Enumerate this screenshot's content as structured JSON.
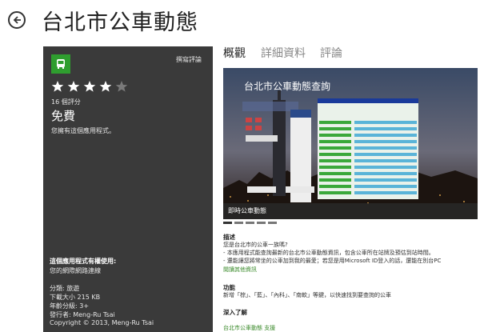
{
  "header": {
    "title": "台北市公車動態"
  },
  "panel": {
    "review_link": "撰寫評論",
    "rating": 4,
    "rating_max": 5,
    "rating_count": "16 個評分",
    "price": "免費",
    "owned_note": "您擁有這個應用程式。",
    "permissions_title": "這個應用程式有權使用:",
    "permissions": [
      "您的網際網路連線"
    ],
    "category": "分類: 旅遊",
    "download_size": "下載大小 215 KB",
    "age_rating": "年齡分級: 3+",
    "publisher": "發行者: Meng-Ru Tsai",
    "copyright": "Copyright © 2013, Meng-Ru Tsai"
  },
  "tabs": [
    "概觀",
    "詳細資料",
    "評論"
  ],
  "screenshot": {
    "app_heading": "台北市公車動態查詢",
    "caption": "即時公車動態",
    "pages": 5,
    "active_page": 0
  },
  "description": {
    "heading": "描述",
    "lines": [
      "您是台北市的公車一族嗎?",
      "- 本應用程式能查詢最新的台北市公車動態資訊，包含公車所在站牌及預估到站時間。",
      "- 還能讓您將常坐的公車加到我的最愛；若您是用Microsoft ID登入的話，還能在別台PC"
    ],
    "more_link": "閱讀其他資訊"
  },
  "features": {
    "heading": "功能",
    "line": "新增「棕」、「藍」、「內科」、「南軟」等鍵，以快速找到要查詢的公車"
  },
  "learn_more": {
    "heading": "深入了解",
    "link": "台北市公車動態 支援"
  },
  "colors": {
    "panel": "#3a3a3a",
    "accent": "#2f9e2f",
    "link": "#3a8a2a"
  }
}
